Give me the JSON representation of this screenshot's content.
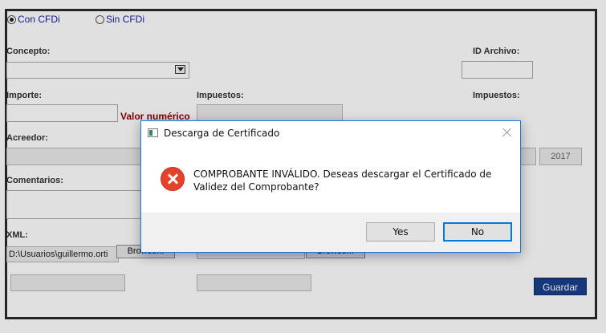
{
  "form": {
    "radio_con": "Con CFDi",
    "radio_sin": "Sin CFDi",
    "concepto_label": "Concepto:",
    "id_archivo_label": "ID Archivo:",
    "importe_label": "Importe:",
    "valor_numerico": "Valor numérico",
    "impuestos_label_1": "Impuestos:",
    "impuestos_label_2": "Impuestos:",
    "acreedor_label": "Acreedor:",
    "year_value": "2017",
    "comentarios_label": "Comentarios:",
    "xml_label": "XML:",
    "xml_value": "D:\\Usuarios\\guillermo.orti",
    "browse_label": "Browse...",
    "browse_label_2": "Browse...",
    "guardar_label": "Guardar"
  },
  "dialog": {
    "title": "Descarga de Certificado",
    "message": "COMPROBANTE INVÁLIDO. Deseas descargar el Certificado de Validez del Comprobante?",
    "yes_label": "Yes",
    "no_label": "No"
  },
  "colors": {
    "accent_blue": "#0078d7",
    "error_red": "#e8412b",
    "guardar_blue": "#1a3f8a",
    "valor_red": "#8b0000"
  }
}
